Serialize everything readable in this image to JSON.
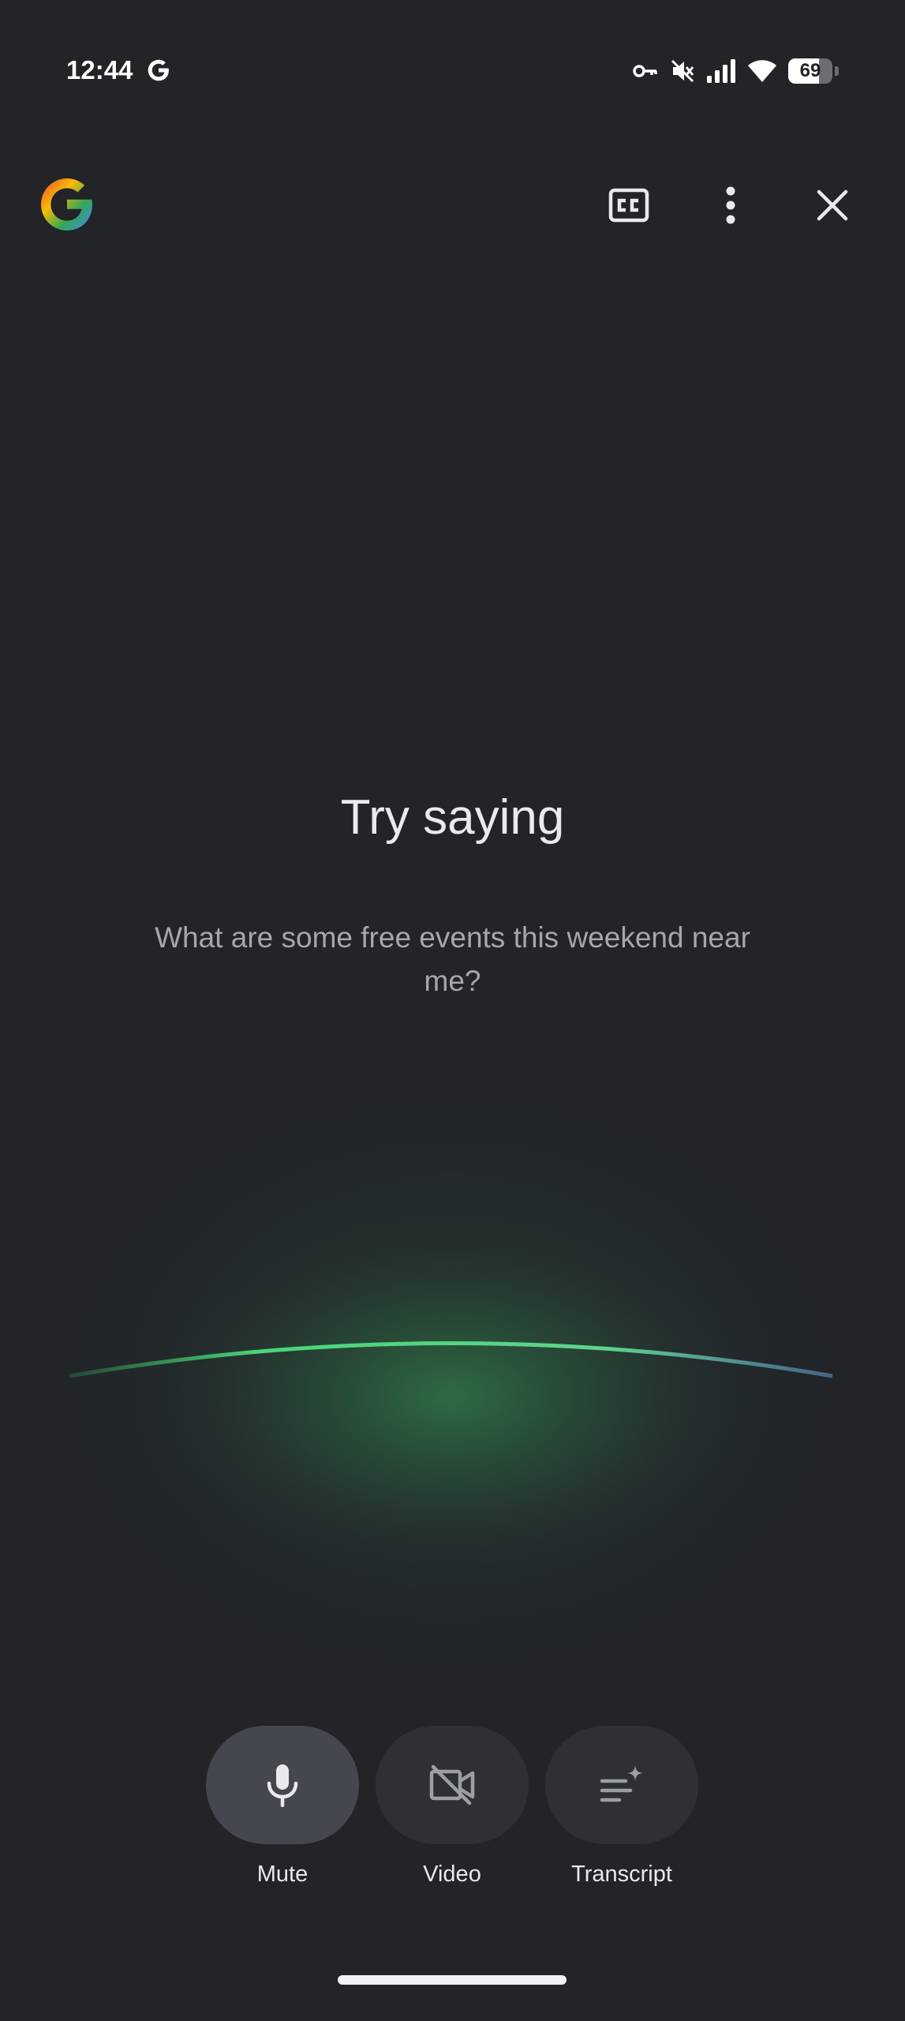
{
  "status_bar": {
    "time": "12:44",
    "battery_level": "69",
    "battery_fraction": 0.69,
    "icons": [
      "google-g-icon",
      "vpn-key-icon",
      "mute-icon",
      "signal-icon",
      "wifi-icon",
      "battery-icon"
    ]
  },
  "top_bar": {
    "logo": "google-logo-icon",
    "actions": [
      "closed-captions-icon",
      "more-vert-icon",
      "close-icon"
    ]
  },
  "prompt": {
    "title": "Try saying",
    "suggestion": "What are some free events this weekend near me?"
  },
  "controls": [
    {
      "label": "Mute",
      "icon": "mic-icon",
      "active": true
    },
    {
      "label": "Video",
      "icon": "video-off-icon",
      "active": false
    },
    {
      "label": "Transcript",
      "icon": "transcript-icon",
      "active": false
    }
  ],
  "colors": {
    "background": "#222428",
    "control_active": "#45474f",
    "control_inactive": "#2e3034",
    "glow_green": "#3ccf6a",
    "arc_blue": "#6aa7d8"
  }
}
